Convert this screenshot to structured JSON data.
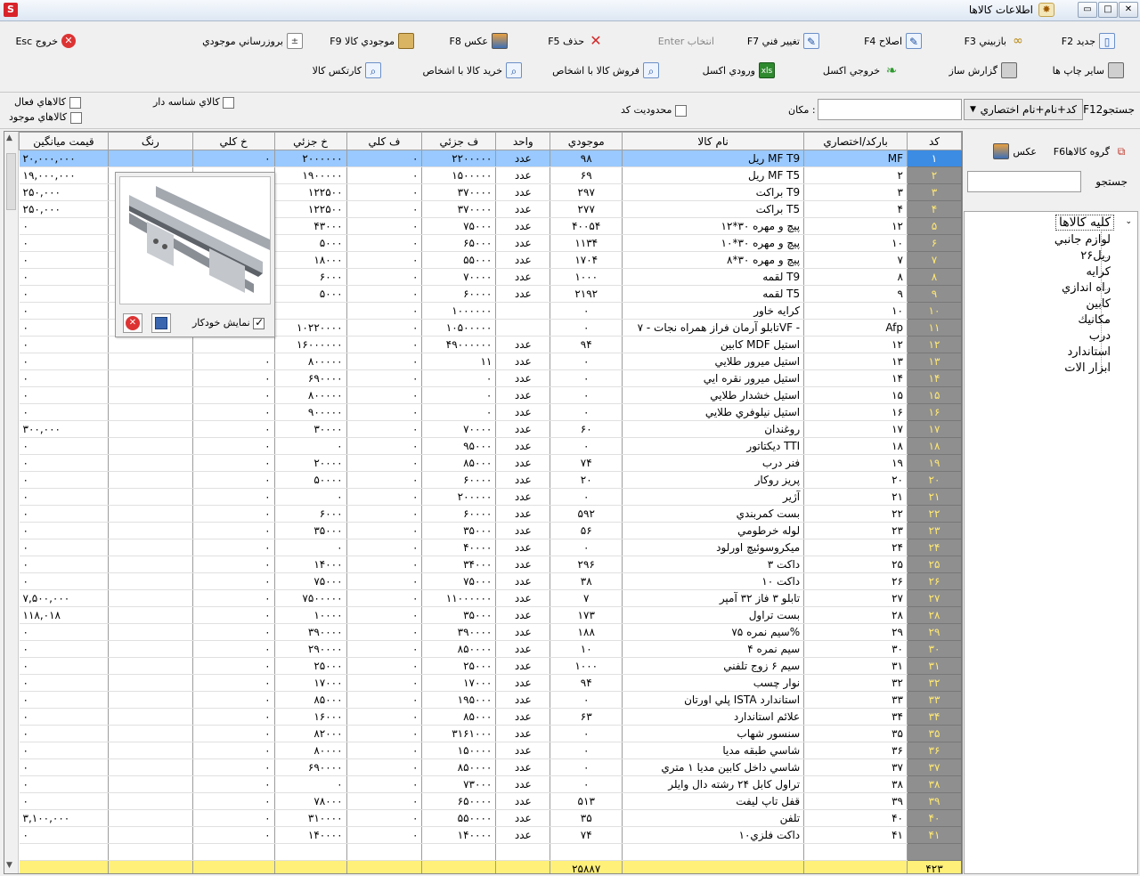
{
  "window": {
    "title": "اطلاعات كالاها",
    "buttons": [
      "▭",
      "□",
      "✕"
    ]
  },
  "toolbar": {
    "row1": [
      {
        "label": "جديد F2",
        "icon": "new-doc-icon"
      },
      {
        "label": "بازبيني F3",
        "icon": "glasses-icon"
      },
      {
        "label": "اصلاح F4",
        "icon": "pencil-icon"
      },
      {
        "label": "تغيير فني F7",
        "icon": "edit-doc-icon"
      },
      {
        "label": "انتخاب Enter",
        "icon": "",
        "disabled": true
      },
      {
        "label": "حذف F5",
        "icon": "delete-x-icon"
      },
      {
        "label": "عكس F8",
        "icon": "photo-icon"
      },
      {
        "label": "موجودي كالا F9",
        "icon": "box-icon"
      },
      {
        "label": "بروزرساني موجودي",
        "icon": "refresh-stock-icon"
      },
      {
        "label": "خروج Esc",
        "icon": "exit-icon"
      }
    ],
    "row2": [
      {
        "label": "ساير چاپ ها",
        "icon": "printer-icon"
      },
      {
        "label": "گزارش ساز",
        "icon": "report-printer-icon"
      },
      {
        "label": "خروجي اكسل",
        "icon": "excel-out-icon"
      },
      {
        "label": "ورودي اكسل",
        "icon": "excel-in-icon"
      },
      {
        "label": "فروش كالا با اشخاص",
        "icon": "sale-search-icon"
      },
      {
        "label": "خريد كالا با اشخاص",
        "icon": "buy-search-icon"
      },
      {
        "label": "كارتكس كالا",
        "icon": "kardex-search-icon"
      }
    ]
  },
  "filters": {
    "search_label": "F12جستجو",
    "search_mode": "كد+نام+نام اختصاري",
    "location_label": "مكان :",
    "limited_code_label": "محدوديت كد",
    "serial_goods_label": "كالاي شناسه دار",
    "active_goods_label": "كالاهاي فعال",
    "existing_goods_label": "كالاهاي موجود"
  },
  "table": {
    "headers": {
      "code": "كد",
      "barcode": "باركد/اختصاري",
      "name": "نام كالا",
      "stock": "موجودي",
      "unit": "واحد",
      "retail_price": "ف جزئي",
      "wholesale_price": "ف كلي",
      "retail_purchase": "خ جزئي",
      "wholesale_purchase": "خ كلي",
      "color": "رنگ",
      "avg_price": "قيمت ميانگين"
    },
    "rows": [
      [
        "۱",
        "MF",
        "ريل  MF  T9",
        "۹۸",
        "عدد",
        "۲۲۰۰۰۰۰",
        "۰",
        "۲۰۰۰۰۰۰",
        "۰",
        "",
        "۲۰,۰۰۰,۰۰۰"
      ],
      [
        "۲",
        "۲",
        "ريل  MF  T5",
        "۶۹",
        "عدد",
        "۱۵۰۰۰۰۰",
        "۰",
        "۱۹۰۰۰۰۰",
        "",
        "",
        "۱۹,۰۰۰,۰۰۰"
      ],
      [
        "۳",
        "۳",
        "براكت T9",
        "۲۹۷",
        "عدد",
        "۳۷۰۰۰۰",
        "۰",
        "۱۲۲۵۰۰",
        "",
        "",
        "۲۵۰,۰۰۰"
      ],
      [
        "۴",
        "۴",
        "براكت T5",
        "۲۷۷",
        "عدد",
        "۳۷۰۰۰۰",
        "۰",
        "۱۲۲۵۰۰",
        "",
        "",
        "۲۵۰,۰۰۰"
      ],
      [
        "۵",
        "۱۲",
        "پيچ و مهره ۳۰*۱۲",
        "۴۰۰۵۴",
        "عدد",
        "۷۵۰۰۰",
        "۰",
        "۴۳۰۰۰",
        "",
        "",
        "۰"
      ],
      [
        "۶",
        "۱۰",
        "پيچ و مهره ۳۰*۱۰",
        "۱۱۳۴",
        "عدد",
        "۶۵۰۰۰",
        "۰",
        "۵۰۰۰",
        "",
        "",
        "۰"
      ],
      [
        "۷",
        "۷",
        "پيچ و مهره ۳۰*۸",
        "۱۷۰۴",
        "عدد",
        "۵۵۰۰۰",
        "۰",
        "۱۸۰۰۰",
        "",
        "",
        "۰"
      ],
      [
        "۸",
        "۸",
        "لقمه T9",
        "۱۰۰۰",
        "عدد",
        "۷۰۰۰۰",
        "۰",
        "۶۰۰۰",
        "",
        "",
        "۰"
      ],
      [
        "۹",
        "۹",
        "لقمه T5",
        "۲۱۹۲",
        "عدد",
        "۶۰۰۰۰",
        "۰",
        "۵۰۰۰",
        "",
        "",
        "۰"
      ],
      [
        "۱۰",
        "۱۰",
        "كرايه خاور",
        "۰",
        "",
        "۱۰۰۰۰۰۰",
        "۰",
        "",
        "",
        "",
        "۰"
      ],
      [
        "۱۱",
        "Afp",
        "تابلو آرمان فراز همراه نجات - ۷VF -",
        "۰",
        "",
        "۱۰۵۰۰۰۰۰",
        "۰",
        "۱۰۲۲۰۰۰۰",
        "",
        "",
        "۰"
      ],
      [
        "۱۲",
        "۱۲",
        "كابين MDF استيل",
        "۹۴",
        "عدد",
        "۴۹۰۰۰۰۰۰",
        "۰",
        "۱۶۰۰۰۰۰۰",
        "",
        "",
        "۰"
      ],
      [
        "۱۳",
        "۱۳",
        "استيل ميرور طلايي",
        "۰",
        "عدد",
        "۱۱",
        "۰",
        "۸۰۰۰۰۰",
        "۰",
        "",
        "۰"
      ],
      [
        "۱۴",
        "۱۴",
        "استيل ميرور نقره ايي",
        "۰",
        "عدد",
        "۰",
        "۰",
        "۶۹۰۰۰۰",
        "۰",
        "",
        "۰"
      ],
      [
        "۱۵",
        "۱۵",
        "استيل خشدار طلايي",
        "۰",
        "عدد",
        "۰",
        "۰",
        "۸۰۰۰۰۰",
        "۰",
        "",
        "۰"
      ],
      [
        "۱۶",
        "۱۶",
        "استيل نيلوفري طلايي",
        "۰",
        "عدد",
        "۰",
        "۰",
        "۹۰۰۰۰۰",
        "۰",
        "",
        "۰"
      ],
      [
        "۱۷",
        "۱۷",
        "روغندان",
        "۶۰",
        "عدد",
        "۷۰۰۰۰",
        "۰",
        "۳۰۰۰۰",
        "۰",
        "",
        "۳۰۰,۰۰۰"
      ],
      [
        "۱۸",
        "۱۸",
        "ديكتاتور TTI",
        "۰",
        "عدد",
        "۹۵۰۰۰",
        "۰",
        "۰",
        "۰",
        "",
        "۰"
      ],
      [
        "۱۹",
        "۱۹",
        "فنر درب",
        "۷۴",
        "عدد",
        "۸۵۰۰۰",
        "۰",
        "۲۰۰۰۰",
        "۰",
        "",
        "۰"
      ],
      [
        "۲۰",
        "۲۰",
        "پريز روكار",
        "۲۰",
        "عدد",
        "۶۰۰۰۰",
        "۰",
        "۵۰۰۰۰",
        "۰",
        "",
        "۰"
      ],
      [
        "۲۱",
        "۲۱",
        "آژير",
        "۰",
        "عدد",
        "۲۰۰۰۰۰",
        "۰",
        "۰",
        "۰",
        "",
        "۰"
      ],
      [
        "۲۲",
        "۲۲",
        "بست كمربندي",
        "۵۹۲",
        "عدد",
        "۶۰۰۰۰",
        "۰",
        "۶۰۰۰",
        "۰",
        "",
        "۰"
      ],
      [
        "۲۳",
        "۲۳",
        "لوله خرطومي",
        "۵۶",
        "عدد",
        "۳۵۰۰۰",
        "۰",
        "۳۵۰۰۰",
        "۰",
        "",
        "۰"
      ],
      [
        "۲۴",
        "۲۴",
        "ميكروسوئيچ اورلود",
        "۰",
        "عدد",
        "۴۰۰۰۰",
        "۰",
        "۰",
        "۰",
        "",
        "۰"
      ],
      [
        "۲۵",
        "۲۵",
        "داكت ۳",
        "۲۹۶",
        "عدد",
        "۳۴۰۰۰",
        "۰",
        "۱۴۰۰۰",
        "۰",
        "",
        "۰"
      ],
      [
        "۲۶",
        "۲۶",
        "داكت ۱۰",
        "۳۸",
        "عدد",
        "۷۵۰۰۰",
        "۰",
        "۷۵۰۰۰",
        "۰",
        "",
        "۰"
      ],
      [
        "۲۷",
        "۲۷",
        "تابلو ۳ فاز ۳۲ آمپر",
        "۷",
        "عدد",
        "۱۱۰۰۰۰۰۰",
        "۰",
        "۷۵۰۰۰۰۰",
        "۰",
        "",
        "۷,۵۰۰,۰۰۰"
      ],
      [
        "۲۸",
        "۲۸",
        "بست تراول",
        "۱۷۳",
        "عدد",
        "۳۵۰۰۰",
        "۰",
        "۱۰۰۰۰",
        "۰",
        "",
        "۱۱۸,۰۱۸"
      ],
      [
        "۲۹",
        "۲۹",
        "سيم نمره ۷۵%",
        "۱۸۸",
        "عدد",
        "۳۹۰۰۰۰",
        "۰",
        "۳۹۰۰۰۰",
        "۰",
        "",
        "۰"
      ],
      [
        "۳۰",
        "۳۰",
        "سيم نمره ۴",
        "۱۰",
        "عدد",
        "۸۵۰۰۰۰",
        "۰",
        "۲۹۰۰۰۰",
        "۰",
        "",
        "۰"
      ],
      [
        "۳۱",
        "۳۱",
        "سيم ۶ زوج تلفني",
        "۱۰۰۰",
        "عدد",
        "۲۵۰۰۰",
        "۰",
        "۲۵۰۰۰",
        "۰",
        "",
        "۰"
      ],
      [
        "۳۲",
        "۳۲",
        "نوار چسب",
        "۹۴",
        "عدد",
        "۱۷۰۰۰",
        "۰",
        "۱۷۰۰۰",
        "۰",
        "",
        "۰"
      ],
      [
        "۳۳",
        "۳۳",
        "پلي اورتان ISTA استاندارد",
        "۰",
        "عدد",
        "۱۹۵۰۰۰",
        "۰",
        "۸۵۰۰۰",
        "۰",
        "",
        "۰"
      ],
      [
        "۳۴",
        "۳۴",
        "علائم استاندارد",
        "۶۳",
        "عدد",
        "۸۵۰۰۰",
        "۰",
        "۱۶۰۰۰",
        "۰",
        "",
        "۰"
      ],
      [
        "۳۵",
        "۳۵",
        "سنسور شهاب",
        "۰",
        "عدد",
        "۳۱۶۱۰۰۰",
        "۰",
        "۸۲۰۰۰",
        "۰",
        "",
        "۰"
      ],
      [
        "۳۶",
        "۳۶",
        "شاسي طبقه مديا",
        "۰",
        "عدد",
        "۱۵۰۰۰۰",
        "۰",
        "۸۰۰۰۰",
        "۰",
        "",
        "۰"
      ],
      [
        "۳۷",
        "۳۷",
        "شاسي داخل كابين مديا ۱ متري",
        "۰",
        "عدد",
        "۸۵۰۰۰۰",
        "۰",
        "۶۹۰۰۰۰",
        "۰",
        "",
        "۰"
      ],
      [
        "۳۸",
        "۳۸",
        "تراول كابل ۲۴ رشته دال وايلر",
        "۰",
        "عدد",
        "۷۳۰۰۰",
        "۰",
        "۰",
        "۰",
        "",
        "۰"
      ],
      [
        "۳۹",
        "۳۹",
        "قفل تاپ ليفت",
        "۵۱۳",
        "عدد",
        "۶۵۰۰۰۰",
        "۰",
        "۷۸۰۰۰",
        "۰",
        "",
        "۰"
      ],
      [
        "۴۰",
        "۴۰",
        "تلفن",
        "۳۵",
        "عدد",
        "۵۵۰۰۰۰",
        "۰",
        "۳۱۰۰۰۰",
        "۰",
        "",
        "۳,۱۰۰,۰۰۰"
      ],
      [
        "۴۱",
        "۴۱",
        "داكت فلزي۱۰",
        "۷۴",
        "عدد",
        "۱۴۰۰۰۰",
        "۰",
        "۱۴۰۰۰۰",
        "۰",
        "",
        "۰"
      ]
    ],
    "summary": {
      "code": "۴۲۳",
      "stock": "۲۵۸۸۷"
    }
  },
  "popup": {
    "auto_show_label": "نمايش خودكار"
  },
  "right_panel": {
    "group_label": "گروه كالاهاF6",
    "photo_label": "عكس",
    "search_label": "جستجو",
    "tree_root": "كليه كالاها",
    "tree_items": [
      "لوازم جانبي",
      "ريل۲۶",
      "كرايه",
      "راه اندازي",
      "كابين",
      "مكانيك",
      "درب",
      "استاندارد",
      "ابزار الات"
    ]
  }
}
